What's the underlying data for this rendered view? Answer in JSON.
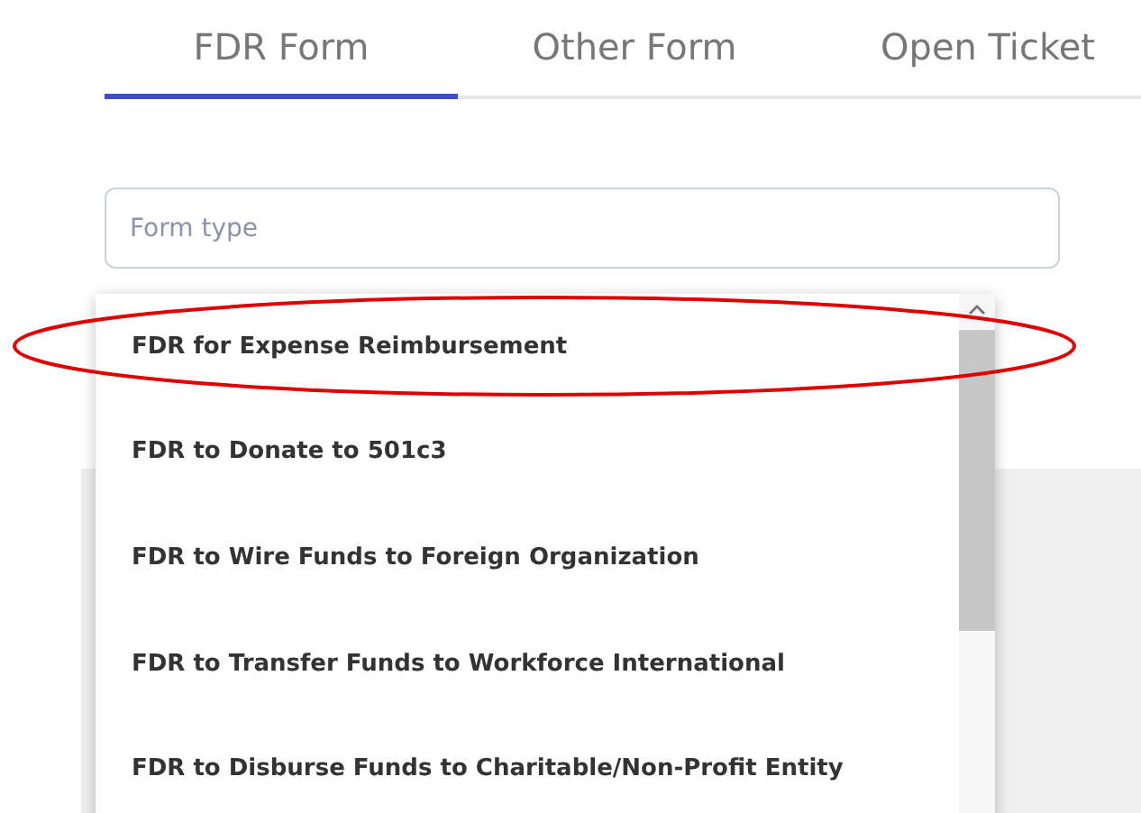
{
  "tabs": [
    {
      "label": "FDR Form",
      "selected": true
    },
    {
      "label": "Other Form",
      "selected": false
    },
    {
      "label": "Open Ticket",
      "selected": false
    }
  ],
  "form_type": {
    "placeholder": "Form type"
  },
  "dropdown": {
    "options": [
      {
        "label": "FDR for Expense Reimbursement",
        "highlighted": true
      },
      {
        "label": "FDR to Donate to 501c3",
        "highlighted": false
      },
      {
        "label": "FDR to Wire Funds to Foreign Organization",
        "highlighted": false
      },
      {
        "label": "FDR to Transfer Funds to Workforce International",
        "highlighted": false
      },
      {
        "label": "FDR to Disburse Funds to Charitable/Non-Profit Entity",
        "highlighted": false
      }
    ]
  }
}
